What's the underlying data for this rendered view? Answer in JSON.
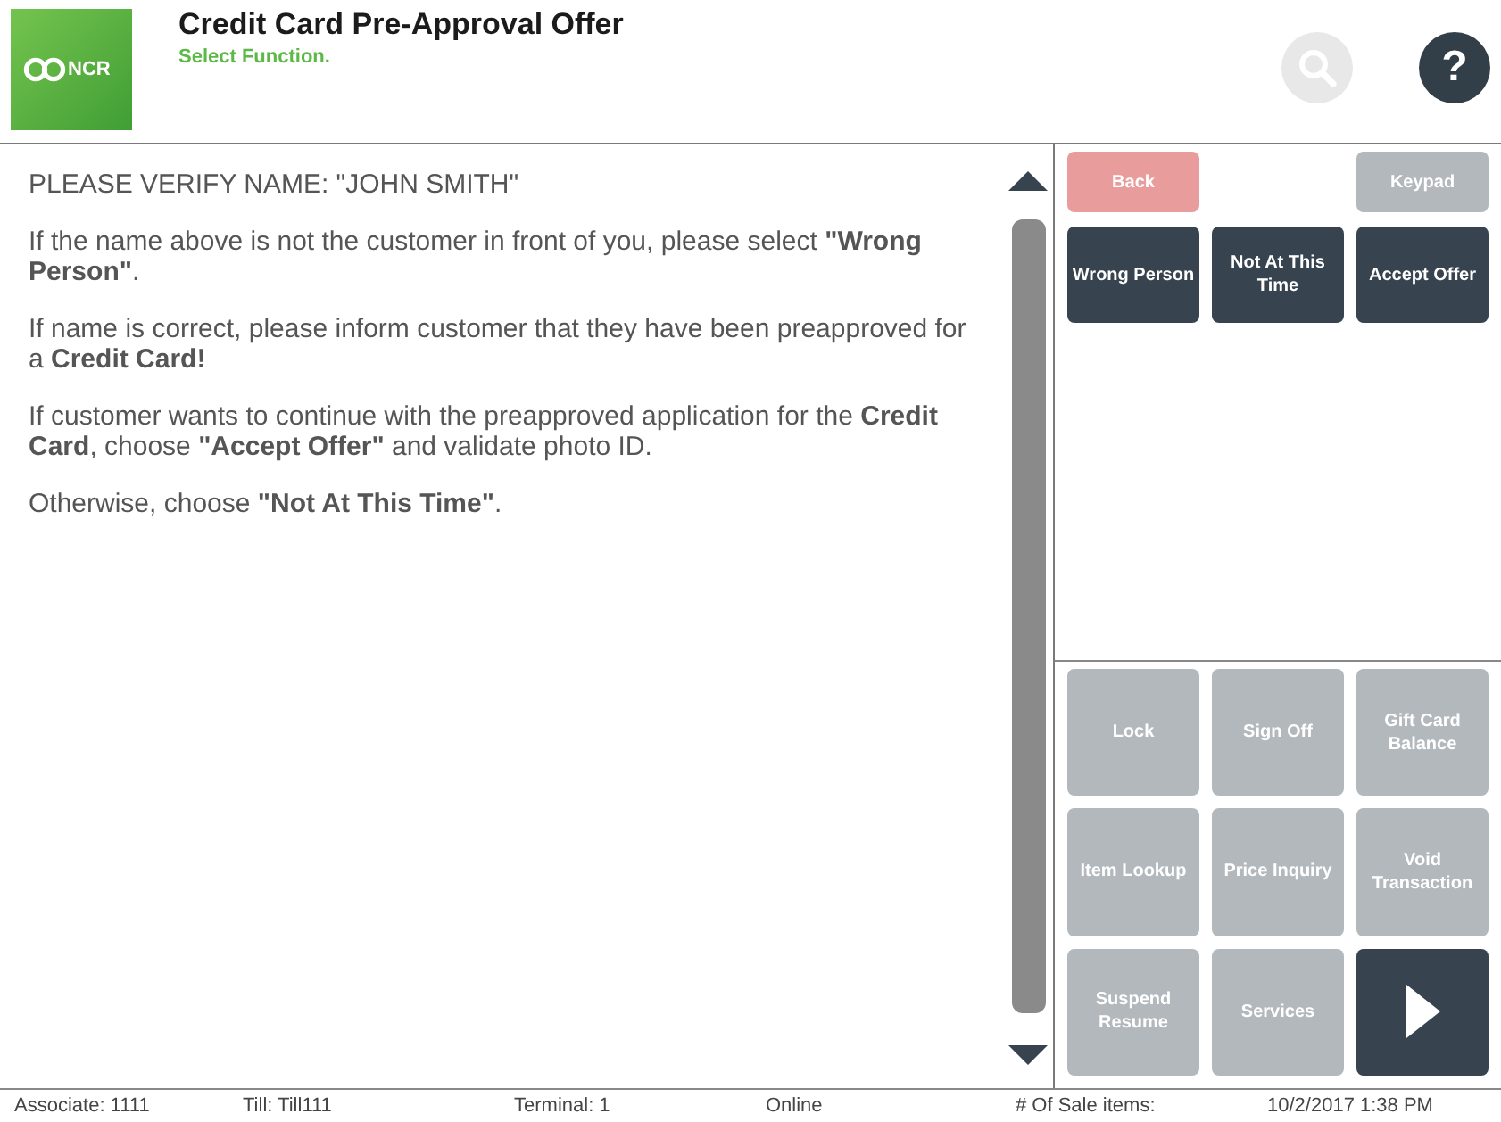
{
  "header": {
    "logo_text": "NCR",
    "title": "Credit Card Pre-Approval Offer",
    "subtitle": "Select Function.",
    "help_label": "?"
  },
  "message": {
    "paragraphs": [
      "PLEASE VERIFY NAME: \"JOHN SMITH\"",
      "If the name above is not the customer in front of you, please select **\"Wrong Person\"**.",
      "If name is correct, please inform customer that they have been preapproved for a **Credit Card!**",
      "If customer wants to continue with the preapproved application for the **Credit Card**, choose **\"Accept Offer\"** and validate photo ID.",
      "Otherwise, choose **\"Not At This Time\"**."
    ]
  },
  "utility_buttons": [
    {
      "label": "Back",
      "kind": "cancel",
      "disabled": true
    },
    {
      "label": "Keypad",
      "kind": "normal",
      "disabled": true
    }
  ],
  "offer_buttons": [
    {
      "label": "Wrong Person",
      "disabled": false
    },
    {
      "label": "Not At This Time",
      "disabled": false
    },
    {
      "label": "Accept Offer",
      "disabled": false
    }
  ],
  "function_buttons": [
    {
      "kind": "text",
      "label": "Lock",
      "disabled": true
    },
    {
      "kind": "text",
      "label": "Sign Off",
      "disabled": true
    },
    {
      "kind": "text",
      "label": "Gift Card Balance",
      "disabled": true
    },
    {
      "kind": "text",
      "label": "Item Lookup",
      "disabled": true
    },
    {
      "kind": "text",
      "label": "Price Inquiry",
      "disabled": true
    },
    {
      "kind": "text",
      "label": "Void Transaction",
      "disabled": true
    },
    {
      "kind": "text",
      "label": "Suspend Resume",
      "disabled": true
    },
    {
      "kind": "text",
      "label": "Services",
      "disabled": true
    },
    {
      "kind": "next",
      "disabled": false
    }
  ],
  "status_bar": [
    "Associate: 1111",
    "Till: Till111",
    "Terminal: 1",
    "Online",
    "# Of Sale items:",
    "10/2/2017 1:38 PM"
  ]
}
